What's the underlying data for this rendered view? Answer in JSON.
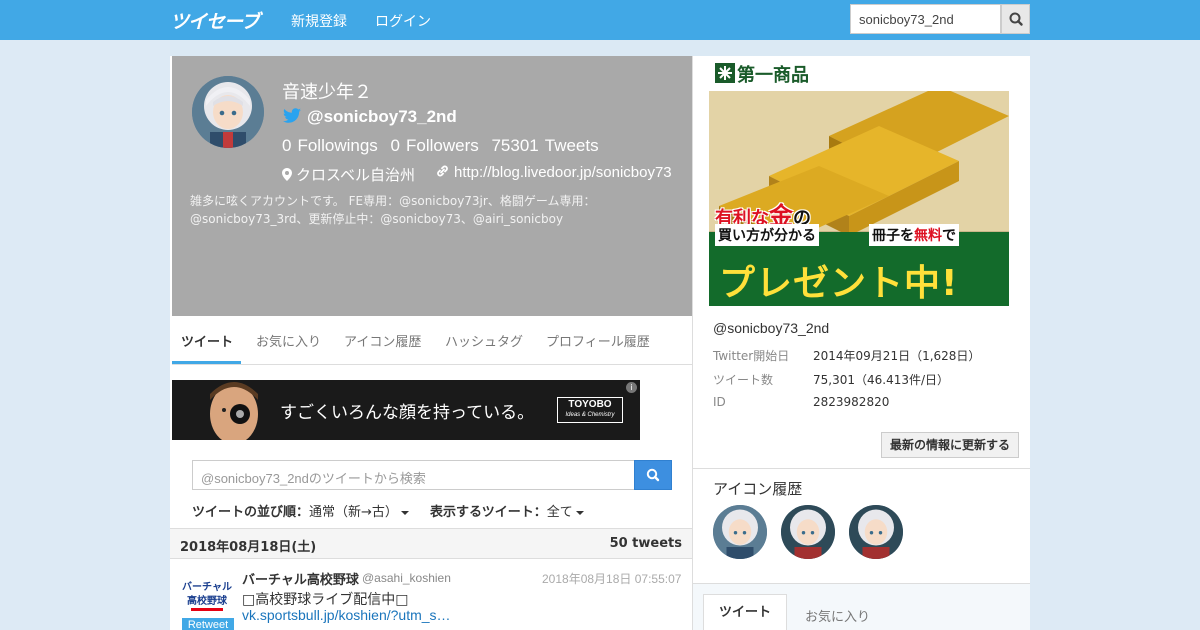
{
  "nav": {
    "logo": "ツイセーブ",
    "links": [
      "新規登録",
      "ログイン"
    ],
    "search_value": "sonicboy73_2nd"
  },
  "profile": {
    "name": "音速少年２",
    "handle": "@sonicboy73_2nd",
    "followings_count": "0",
    "followings_label": "Followings",
    "followers_count": "0",
    "followers_label": "Followers",
    "tweets_count": "75301",
    "tweets_label": "Tweets",
    "location": "クロスベル自治州",
    "url": "http://blog.livedoor.jp/sonicboy73",
    "bio": "雑多に呟くアカウントです。 FE専用：@sonicboy73jr、格闘ゲーム専用：@sonicboy73_3rd、更新停止中：@sonicboy73、@airi_sonicboy"
  },
  "tabs": [
    "ツイート",
    "お気に入り",
    "アイコン履歴",
    "ハッシュタグ",
    "プロフィール履歴"
  ],
  "banner": {
    "text": "すごくいろんな顔を持っている。",
    "logo_line1": "TOYOBO",
    "logo_line2": "Ideas & Chemistry",
    "info": "i"
  },
  "tweet_search": {
    "placeholder": "@sonicboy73_2ndのツイートから検索"
  },
  "sort": {
    "order_label": "ツイートの並び順：",
    "order_value": "通常（新→古）",
    "filter_label": "表示するツイート：",
    "filter_value": "全て"
  },
  "date_header": {
    "date": "2018年08月18日(土)",
    "count": "50 tweets"
  },
  "tweet": {
    "name": "バーチャル高校野球",
    "handle": "@asahi_koshien",
    "time": "2018年08月18日 07:55:07",
    "text": "□高校野球ライブ配信中□",
    "link": "vk.sportsbull.jp/koshien/?utm_s…",
    "badge": "Retweet",
    "avatar_text": "バーチャル高校野球"
  },
  "ad": {
    "brand": "第一商品",
    "line1_a": "有利な",
    "line1_b": "金",
    "line1_c": "の",
    "line2": "買い方が分かる",
    "booklet_a": "冊子を",
    "booklet_b": "無料",
    "booklet_c": "で",
    "line3": "プレゼント中!"
  },
  "account": {
    "handle": "@sonicboy73_2nd",
    "rows": [
      {
        "key": "Twitter開始日",
        "value": "2014年09月21日（1,628日）"
      },
      {
        "key": "ツイート数",
        "value": "75,301（46.413件/日）"
      },
      {
        "key": "ID",
        "value": "2823982820"
      }
    ],
    "update_button": "最新の情報に更新する"
  },
  "icon_history": {
    "title": "アイコン履歴"
  },
  "right_tabs": [
    "ツイート",
    "お気に入り"
  ],
  "colors": {
    "nav_bg": "#41a8e6",
    "profile_bg": "#a9a9a9",
    "link": "#1a75bc",
    "search_btn": "#3d8fe0"
  }
}
